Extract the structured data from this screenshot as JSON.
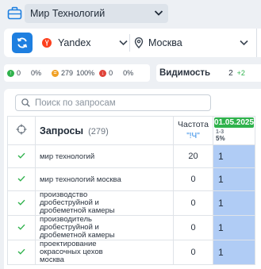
{
  "project": {
    "name": "Мир Технологий"
  },
  "filters": {
    "search_engine": "Yandex",
    "region": "Москва"
  },
  "stats": {
    "up": {
      "count": "0",
      "percent": "0%"
    },
    "same": {
      "count": "279",
      "percent": "100%"
    },
    "down": {
      "count": "0",
      "percent": "0%"
    }
  },
  "visibility": {
    "label": "Видимость",
    "value": "2",
    "delta": "+2"
  },
  "search": {
    "placeholder": "Поиск по запросам"
  },
  "table": {
    "header": {
      "queries_label": "Запросы",
      "queries_count": "(279)",
      "frequency_label": "Частота",
      "frequency_mode": "\"!Ч\"",
      "date": "01.05.2025",
      "date_range": "1-3",
      "date_percent": "5%"
    },
    "rows": [
      {
        "query": "мир технологий",
        "frequency": "20",
        "position": "1"
      },
      {
        "query": "мир технологий москва",
        "frequency": "0",
        "position": "1"
      },
      {
        "query": "производство дробеструйной и дробеметной камеры",
        "frequency": "0",
        "position": "1"
      },
      {
        "query": "производитель дробеструйной и дробеметной камеры",
        "frequency": "0",
        "position": "1"
      },
      {
        "query": "проектирование окрасочных цехов москва",
        "frequency": "0",
        "position": "1"
      }
    ]
  },
  "colors": {
    "accent": "#1e7fe0",
    "up": "#2fb24c",
    "same": "#f0a024",
    "down": "#e0443a",
    "position_highlight": "#b0ccf5"
  }
}
